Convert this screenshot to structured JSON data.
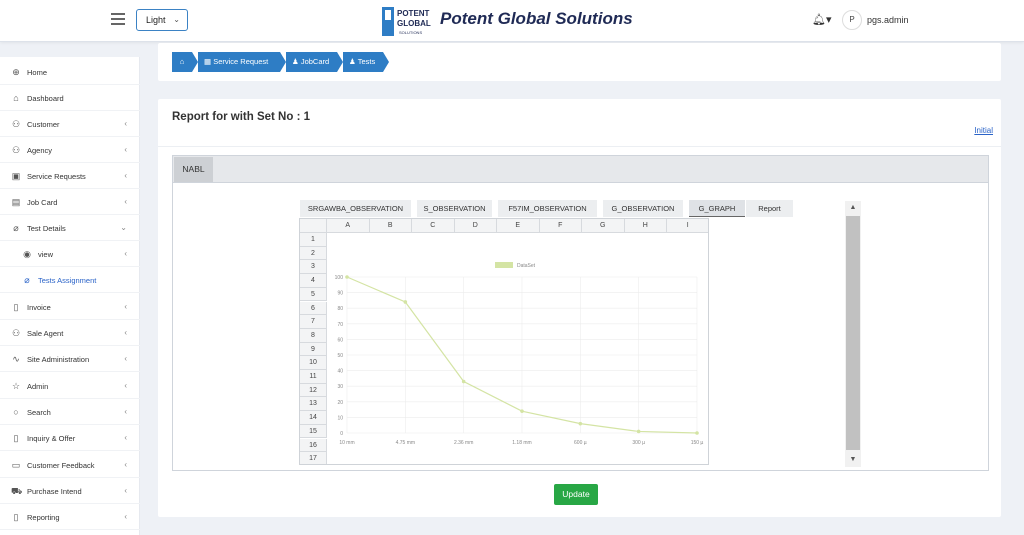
{
  "header": {
    "theme_value": "Light",
    "brand": "Potent Global Solutions",
    "logo_text_1": "POTENT",
    "logo_text_2": "GLOBAL",
    "logo_text_3": "SOLUTIONS",
    "avatar_initial": "P",
    "username": "pgs.admin"
  },
  "sidebar": {
    "items": [
      {
        "label": "Home",
        "icon": "globe-icon",
        "glyph": "⊕",
        "arrow": ""
      },
      {
        "label": "Dashboard",
        "icon": "home-icon",
        "glyph": "⌂",
        "arrow": ""
      },
      {
        "label": "Customer",
        "icon": "users-icon",
        "glyph": "⚇",
        "arrow": "‹"
      },
      {
        "label": "Agency",
        "icon": "users-icon",
        "glyph": "⚇",
        "arrow": "‹"
      },
      {
        "label": "Service Requests",
        "icon": "briefcase-icon",
        "glyph": "▣",
        "arrow": "‹"
      },
      {
        "label": "Job Card",
        "icon": "card-icon",
        "glyph": "▤",
        "arrow": "‹"
      },
      {
        "label": "Test Details",
        "icon": "thermometer-icon",
        "glyph": "⌀",
        "arrow": "⌄"
      },
      {
        "label": "view",
        "icon": "eye-icon",
        "glyph": "◉",
        "arrow": "‹"
      },
      {
        "label": "Tests Assignment",
        "icon": "thermometer-icon",
        "glyph": "⌀",
        "arrow": ""
      },
      {
        "label": "Invoice",
        "icon": "file-icon",
        "glyph": "▯",
        "arrow": "‹"
      },
      {
        "label": "Sale Agent",
        "icon": "users-icon",
        "glyph": "⚇",
        "arrow": "‹"
      },
      {
        "label": "Site Administration",
        "icon": "activity-icon",
        "glyph": "∿",
        "arrow": "‹"
      },
      {
        "label": "Admin",
        "icon": "star-icon",
        "glyph": "☆",
        "arrow": "‹"
      },
      {
        "label": "Search",
        "icon": "search-icon",
        "glyph": "○",
        "arrow": "‹"
      },
      {
        "label": "Inquiry & Offer",
        "icon": "file-icon",
        "glyph": "▯",
        "arrow": "‹"
      },
      {
        "label": "Customer Feedback",
        "icon": "message-icon",
        "glyph": "▭",
        "arrow": "‹"
      },
      {
        "label": "Purchase Intend",
        "icon": "cart-icon",
        "glyph": "⛟",
        "arrow": "‹"
      },
      {
        "label": "Reporting",
        "icon": "file-icon",
        "glyph": "▯",
        "arrow": "‹"
      }
    ]
  },
  "breadcrumb": {
    "home_glyph": "⌂",
    "items": [
      {
        "label": "Service Request",
        "glyph": "▦"
      },
      {
        "label": "JobCard",
        "glyph": "♟"
      },
      {
        "label": "Tests",
        "glyph": "♟"
      }
    ]
  },
  "main": {
    "title": "Report for with Set No : 1",
    "initial_link": "Initial",
    "nabl_tab": "NABL",
    "sheet_tabs": [
      "SRGAWBA_OBSERVATION",
      "S_OBSERVATION",
      "F57IM_OBSERVATION",
      "G_OBSERVATION",
      "G_GRAPH",
      "Report"
    ],
    "active_sheet": "G_GRAPH",
    "columns": [
      "A",
      "B",
      "C",
      "D",
      "E",
      "F",
      "G",
      "H",
      "I"
    ],
    "rows": [
      "1",
      "2",
      "3",
      "4",
      "5",
      "6",
      "7",
      "8",
      "9",
      "10",
      "11",
      "12",
      "13",
      "14",
      "15",
      "16",
      "17"
    ],
    "update_label": "Update"
  },
  "colors": {
    "accent": "#2e7dc5",
    "success": "#28a745",
    "series": "#d4e4a4"
  },
  "chart_data": {
    "type": "line",
    "categories": [
      "10 mm",
      "4.75 mm",
      "2.36 mm",
      "1.18 mm",
      "600 µ",
      "300 µ",
      "150 µ"
    ],
    "series": [
      {
        "name": "DataSet",
        "values": [
          100,
          84,
          33,
          14,
          6,
          1,
          0
        ]
      }
    ],
    "y_ticks": [
      0,
      10,
      20,
      30,
      40,
      50,
      60,
      70,
      80,
      90,
      100
    ],
    "ylim": [
      0,
      100
    ],
    "grid": true,
    "legend": "top-center"
  }
}
